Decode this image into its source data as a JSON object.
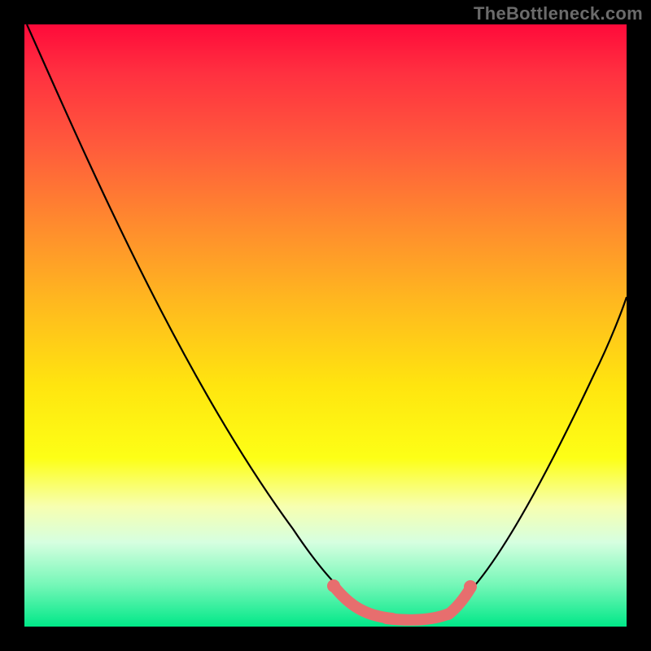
{
  "watermark": "TheBottleneck.com",
  "chart_data": {
    "type": "line",
    "title": "",
    "xlabel": "",
    "ylabel": "",
    "xlim": [
      0,
      100
    ],
    "ylim": [
      0,
      100
    ],
    "grid": false,
    "series": [
      {
        "name": "bottleneck-curve",
        "color": "#000000",
        "x": [
          0,
          4,
          8,
          12,
          16,
          20,
          24,
          28,
          32,
          36,
          40,
          44,
          48,
          50,
          52,
          54,
          56,
          58,
          60,
          62,
          64,
          66,
          70,
          74,
          78,
          82,
          86,
          90,
          94,
          98,
          100
        ],
        "y": [
          100,
          92,
          85,
          77,
          70,
          62,
          55,
          48,
          41,
          34,
          27,
          21,
          14,
          11,
          8,
          6,
          4,
          2.5,
          1.5,
          1.2,
          1.2,
          1.5,
          4,
          8,
          14,
          21,
          29,
          37,
          45,
          53,
          57
        ]
      },
      {
        "name": "sweet-spot-highlight",
        "color": "#e76e6e",
        "x": [
          50,
          52,
          54,
          56,
          58,
          60,
          62,
          64,
          66,
          68,
          70,
          72
        ],
        "y": [
          10,
          7,
          5,
          3.5,
          2.3,
          1.5,
          1.2,
          1.2,
          1.6,
          2.5,
          4,
          6
        ]
      }
    ],
    "background_gradient": {
      "top_color": "#ff0a3a",
      "bottom_color": "#00e888",
      "meaning": "red = high bottleneck, green = low bottleneck"
    }
  }
}
